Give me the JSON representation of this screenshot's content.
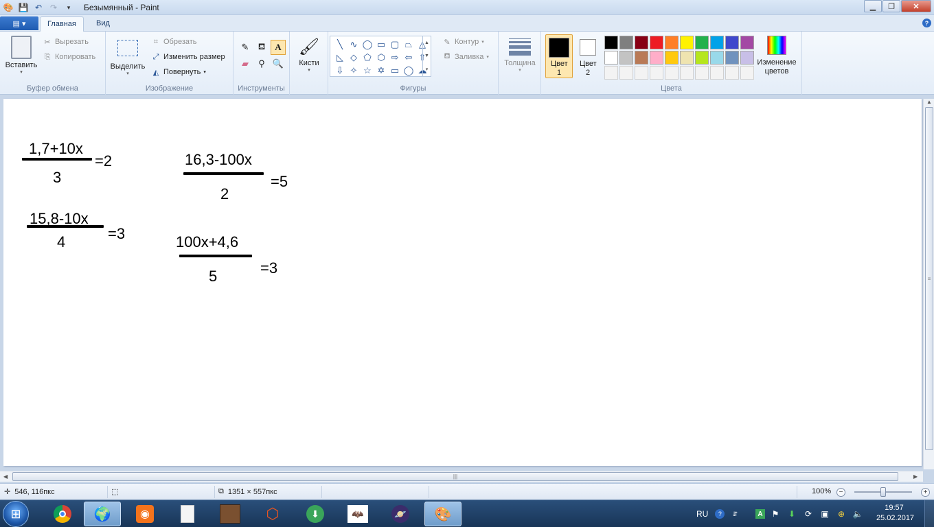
{
  "window": {
    "title": "Безымянный - Paint"
  },
  "tabs": {
    "file_label": "▤ ▾",
    "home": "Главная",
    "view": "Вид"
  },
  "clipboard": {
    "paste": "Вставить",
    "cut": "Вырезать",
    "copy": "Копировать",
    "group": "Буфер обмена"
  },
  "image": {
    "select": "Выделить",
    "crop": "Обрезать",
    "resize": "Изменить размер",
    "rotate": "Повернуть",
    "group": "Изображение"
  },
  "tools": {
    "group": "Инструменты"
  },
  "brushes": {
    "label": "Кисти"
  },
  "shapes": {
    "outline": "Контур",
    "fill": "Заливка",
    "group": "Фигуры"
  },
  "thickness": {
    "label": "Толщина"
  },
  "colors": {
    "color1_label": "Цвет 1",
    "color2_label": "Цвет 2",
    "edit_colors": "Изменение цветов",
    "group": "Цвета",
    "color1": "#000000",
    "color2": "#ffffff",
    "palette_row1": [
      "#000000",
      "#7f7f7f",
      "#880015",
      "#ed1c24",
      "#ff7f27",
      "#fff200",
      "#22b14c",
      "#00a2e8",
      "#3f48cc",
      "#a349a4"
    ],
    "palette_row2": [
      "#ffffff",
      "#c3c3c3",
      "#b97a57",
      "#ffaec9",
      "#ffc90e",
      "#efe4b0",
      "#b5e61d",
      "#99d9ea",
      "#7092be",
      "#c8bfe7"
    ]
  },
  "canvas": {
    "eq1": {
      "numerator": "1,7+10x",
      "denominator": "3",
      "rhs": "=2"
    },
    "eq2": {
      "numerator": "16,3-100x",
      "denominator": "2",
      "rhs": "=5"
    },
    "eq3": {
      "numerator": "15,8-10x",
      "denominator": "4",
      "rhs": "=3"
    },
    "eq4": {
      "numerator": "100x+4,6",
      "denominator": "5",
      "rhs": "=3"
    }
  },
  "status": {
    "cursor_pos": "546, 116пкс",
    "canvas_size": "1351 × 557пкс",
    "zoom": "100%"
  },
  "taskbar": {
    "lang": "RU",
    "time": "19:57",
    "date": "25.02.2017"
  }
}
